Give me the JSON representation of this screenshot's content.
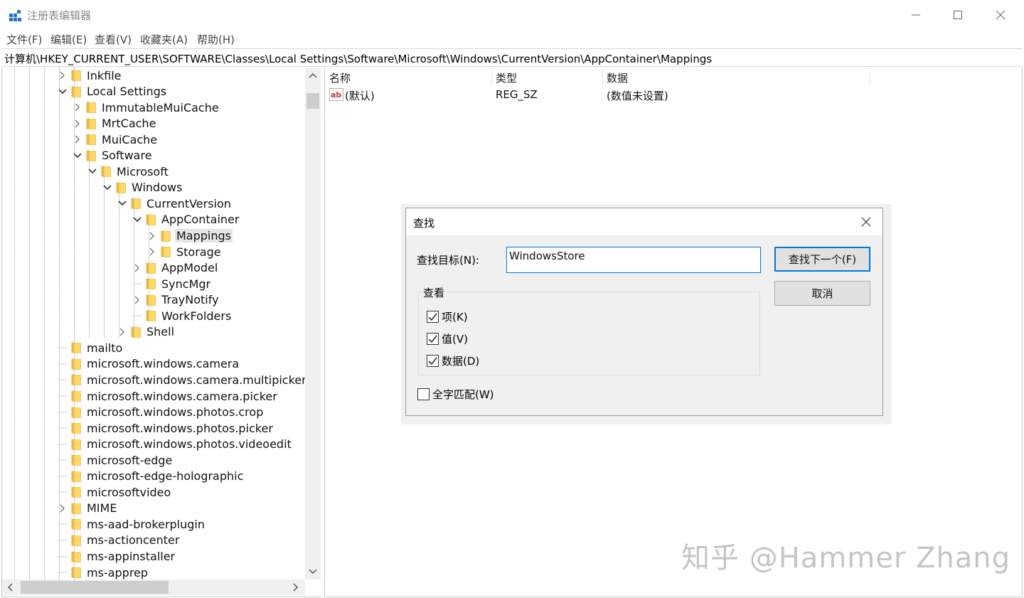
{
  "window": {
    "title": "注册表编辑器",
    "menu": [
      "文件(F)",
      "编辑(E)",
      "查看(V)",
      "收藏夹(A)",
      "帮助(H)"
    ],
    "address": "计算机\\HKEY_CURRENT_USER\\SOFTWARE\\Classes\\Local Settings\\Software\\Microsoft\\Windows\\CurrentVersion\\AppContainer\\Mappings"
  },
  "tree": {
    "items": [
      {
        "label": "Inkfile",
        "state": "collapsed",
        "selected": false
      },
      {
        "label": "Local Settings",
        "state": "expanded",
        "selected": false
      },
      {
        "label": "ImmutableMuiCache",
        "state": "collapsed",
        "selected": false
      },
      {
        "label": "MrtCache",
        "state": "collapsed",
        "selected": false
      },
      {
        "label": "MuiCache",
        "state": "collapsed",
        "selected": false
      },
      {
        "label": "Software",
        "state": "expanded",
        "selected": false
      },
      {
        "label": "Microsoft",
        "state": "expanded",
        "selected": false
      },
      {
        "label": "Windows",
        "state": "expanded",
        "selected": false
      },
      {
        "label": "CurrentVersion",
        "state": "expanded",
        "selected": false
      },
      {
        "label": "AppContainer",
        "state": "expanded",
        "selected": false
      },
      {
        "label": "Mappings",
        "state": "collapsed",
        "selected": true
      },
      {
        "label": "Storage",
        "state": "collapsed",
        "selected": false
      },
      {
        "label": "AppModel",
        "state": "collapsed",
        "selected": false
      },
      {
        "label": "SyncMgr",
        "state": "leaf",
        "selected": false
      },
      {
        "label": "TrayNotify",
        "state": "collapsed",
        "selected": false
      },
      {
        "label": "WorkFolders",
        "state": "leaf",
        "selected": false
      },
      {
        "label": "Shell",
        "state": "collapsed",
        "selected": false
      },
      {
        "label": "mailto",
        "state": "leaf",
        "selected": false
      },
      {
        "label": "microsoft.windows.camera",
        "state": "leaf",
        "selected": false
      },
      {
        "label": "microsoft.windows.camera.multipicker",
        "state": "leaf",
        "selected": false
      },
      {
        "label": "microsoft.windows.camera.picker",
        "state": "leaf",
        "selected": false
      },
      {
        "label": "microsoft.windows.photos.crop",
        "state": "leaf",
        "selected": false
      },
      {
        "label": "microsoft.windows.photos.picker",
        "state": "leaf",
        "selected": false
      },
      {
        "label": "microsoft.windows.photos.videoedit",
        "state": "leaf",
        "selected": false
      },
      {
        "label": "microsoft-edge",
        "state": "leaf",
        "selected": false
      },
      {
        "label": "microsoft-edge-holographic",
        "state": "leaf",
        "selected": false
      },
      {
        "label": "microsoftvideo",
        "state": "leaf",
        "selected": false
      },
      {
        "label": "MIME",
        "state": "collapsed",
        "selected": false
      },
      {
        "label": "ms-aad-brokerplugin",
        "state": "leaf",
        "selected": false
      },
      {
        "label": "ms-actioncenter",
        "state": "leaf",
        "selected": false
      },
      {
        "label": "ms-appinstaller",
        "state": "leaf",
        "selected": false
      },
      {
        "label": "ms-apprep",
        "state": "leaf",
        "selected": false
      }
    ]
  },
  "values": {
    "headers": {
      "name": "名称",
      "type": "类型",
      "data": "数据"
    },
    "rows": [
      {
        "name": "(默认)",
        "type": "REG_SZ",
        "data": "(数值未设置)",
        "icon": "string-value-icon"
      }
    ]
  },
  "find_dialog": {
    "title": "查找",
    "target_label": "查找目标(N):",
    "target_value": "WindowsStore",
    "find_next": "查找下一个(F)",
    "cancel": "取消",
    "look_at_label": "查看",
    "options": [
      {
        "label": "项(K)",
        "checked": true
      },
      {
        "label": "值(V)",
        "checked": true
      },
      {
        "label": "数据(D)",
        "checked": true
      }
    ],
    "match_whole": {
      "label": "全字匹配(W)",
      "checked": false
    }
  },
  "watermark": "知乎 @Hammer Zhang",
  "colors": {
    "accent": "#0078d7",
    "folder": "#ffd866",
    "selection": "#e5e5e5"
  }
}
